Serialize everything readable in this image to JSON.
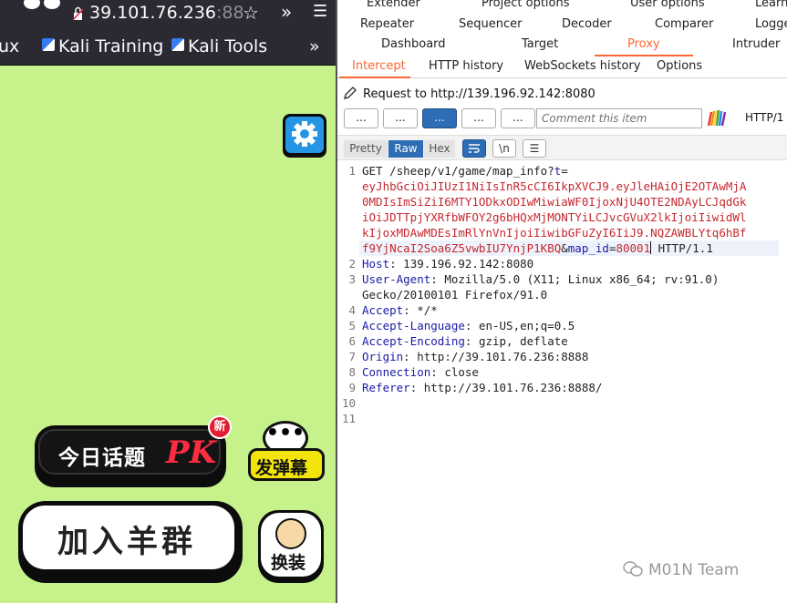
{
  "browser": {
    "url_main": "39.101.76.236",
    "url_port_partial": ":88",
    "bookmarks": [
      "ux",
      "Kali Training",
      "Kali Tools"
    ]
  },
  "game": {
    "topic_pk_label": "今日话题",
    "pk_text": "PK",
    "new_badge": "新",
    "danmu_label": "发弹幕",
    "danmu_bubble": "•••",
    "join_group_label": "加入羊群",
    "change_skin_label": "换装"
  },
  "burp": {
    "main_tabs_row1": [
      "Extender",
      "Project options",
      "User options",
      "Learn"
    ],
    "main_tabs_row2": [
      "Repeater",
      "Sequencer",
      "Decoder",
      "Comparer",
      "Logge"
    ],
    "main_tabs_row3": [
      "Dashboard",
      "Target",
      "Proxy",
      "Intruder"
    ],
    "sub_tabs": [
      "Intercept",
      "HTTP history",
      "WebSockets history",
      "Options"
    ],
    "request_header": "Request to http://139.196.92.142:8080",
    "toolbar_buttons": [
      "...",
      "...",
      "...",
      "...",
      "..."
    ],
    "comment_placeholder": "Comment this item",
    "http_version": "HTTP/1",
    "view_modes": [
      "Pretty",
      "Raw",
      "Hex"
    ],
    "active_view_mode": "Raw",
    "newline_toggle": "\\n",
    "line_numbers": [
      "1",
      "2",
      "3",
      "4",
      "5",
      "6",
      "7",
      "8",
      "9",
      "10",
      "11"
    ],
    "request": {
      "line1_prefix": "GET /sheep/v1/game/map_info?",
      "param_t_key": "t",
      "eq": "=",
      "jwt_lines": [
        "eyJhbGciOiJIUzI1NiIsInR5cCI6IkpXVCJ9.eyJleHAiOjE2OTAwMjA",
        "0MDIsImSiZiI6MTY1ODkxODIwMiwiaWF0IjoxNjU4OTE2NDAyLCJqdGk",
        "iOiJDTTpjYXRfbWFOY2g6bHQxMjMONTYiLCJvcGVuX2lkIjoiIiwidWl",
        "kIjoxMDAwMDEsImRlYnVnIjoiIiwibGFuZyI6IiJ9.NQZAWBLYtq6hBf",
        "f9YjNcaI2Soa6Z5vwbIU7YnjP1KBQ"
      ],
      "amp": "&",
      "param_map_key": "map_id",
      "param_map_val": "80001",
      "line1_suffix": " HTTP/1.1",
      "headers": [
        {
          "name": "Host",
          "value": " 139.196.92.142:8080"
        },
        {
          "name": "User-Agent",
          "value": " Mozilla/5.0 (X11; Linux x86_64; rv:91.0)"
        },
        {
          "name": "",
          "value": "Gecko/20100101 Firefox/91.0"
        },
        {
          "name": "Accept",
          "value": " */*"
        },
        {
          "name": "Accept-Language",
          "value": " en-US,en;q=0.5"
        },
        {
          "name": "Accept-Encoding",
          "value": " gzip, deflate"
        },
        {
          "name": "Origin",
          "value": " http://39.101.76.236:8888"
        },
        {
          "name": "Connection",
          "value": " close"
        },
        {
          "name": "Referer",
          "value": " http://39.101.76.236:8888/"
        }
      ]
    }
  },
  "watermark": "M01N Team",
  "colors": {
    "game_bg": "#c7f28b",
    "burp_accent": "#ff6633",
    "burp_blue": "#2d6db5",
    "param_red": "#c5282f",
    "header_blue": "#1a1aa6"
  }
}
